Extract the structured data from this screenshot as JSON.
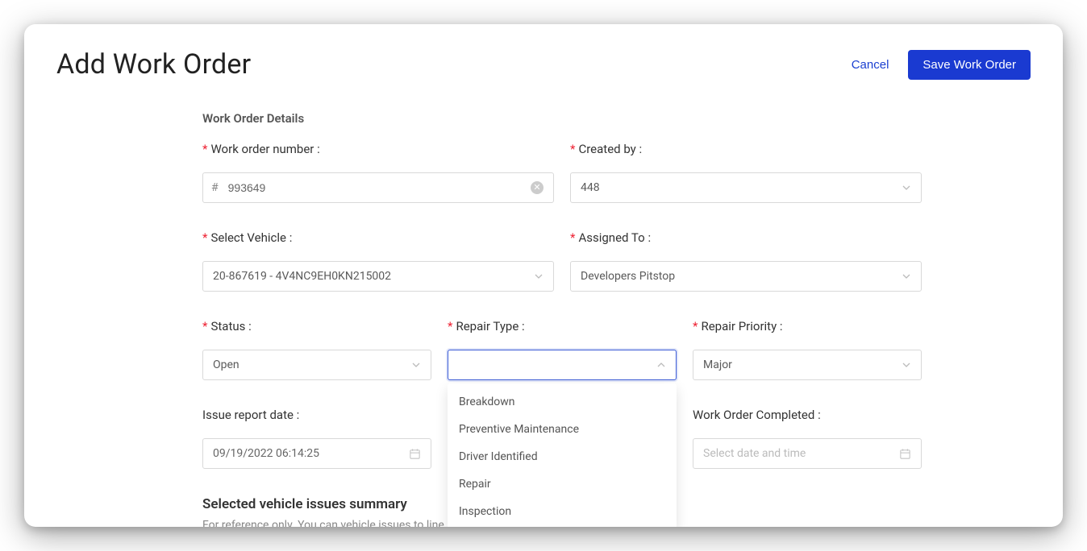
{
  "header": {
    "title": "Add Work Order",
    "cancel_label": "Cancel",
    "save_label": "Save Work Order"
  },
  "section": {
    "details_title": "Work Order Details",
    "summary_title": "Selected vehicle issues summary",
    "summary_sub": "For reference only. You can vehicle issues to line items in the next section."
  },
  "fields": {
    "work_order_number": {
      "label": "Work order number",
      "prefix": "#",
      "value": "993649"
    },
    "created_by": {
      "label": "Created by",
      "value": "448"
    },
    "select_vehicle": {
      "label": "Select Vehicle",
      "value": "20-867619 - 4V4NC9EH0KN215002"
    },
    "assigned_to": {
      "label": "Assigned To",
      "value": "Developers Pitstop"
    },
    "status": {
      "label": "Status",
      "value": "Open"
    },
    "repair_type": {
      "label": "Repair Type",
      "value": ""
    },
    "repair_priority": {
      "label": "Repair Priority",
      "value": "Major"
    },
    "issue_report_date": {
      "label": "Issue report date",
      "value": "09/19/2022 06:14:25"
    },
    "work_order_completed": {
      "label": "Work Order Completed",
      "value": "",
      "placeholder": "Select date and time"
    }
  },
  "repair_type_options": [
    "Breakdown",
    "Preventive Maintenance",
    "Driver Identified",
    "Repair",
    "Inspection"
  ]
}
